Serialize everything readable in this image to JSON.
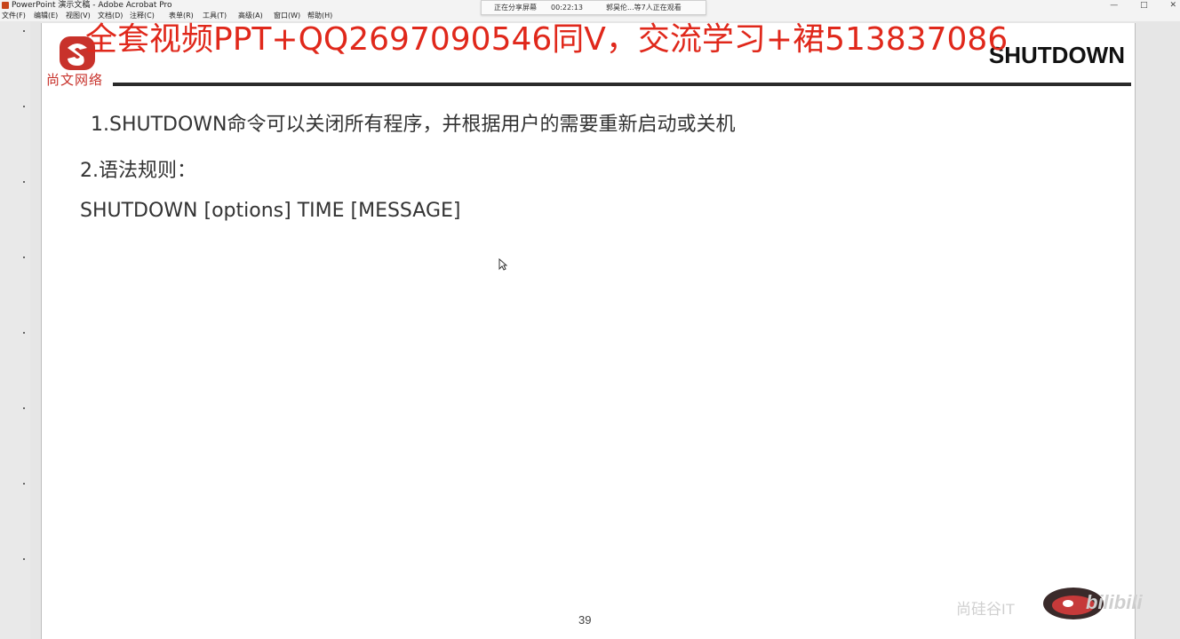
{
  "window": {
    "title": "PowerPoint 演示文稿 - Adobe Acrobat Pro",
    "controls": [
      "—",
      "□",
      "✕"
    ]
  },
  "menu": [
    "文件(F)",
    "编辑(E)",
    "视图(V)",
    "文档(D)",
    "注释(C)",
    "表单(R)",
    "工具(T)",
    "高级(A)",
    "窗口(W)",
    "帮助(H)"
  ],
  "share_bar": {
    "status": "正在分享屏幕",
    "time": "00:22:13",
    "viewers": "郭昊伦...等7人正在观看"
  },
  "logo_text": "尚文网络",
  "watermark": "全套视频PPT+QQ2697090546同V，交流学习+裙513837086",
  "slide": {
    "title": "SHUTDOWN",
    "line1": "1.SHUTDOWN命令可以关闭所有程序，并根据用户的需要重新启动或关机",
    "line2": "2.语法规则：",
    "line3": "SHUTDOWN [options] TIME [MESSAGE]",
    "page_number": "39"
  },
  "bottom_watermark": {
    "text": "尚硅谷IT",
    "brand": "bilibili"
  }
}
